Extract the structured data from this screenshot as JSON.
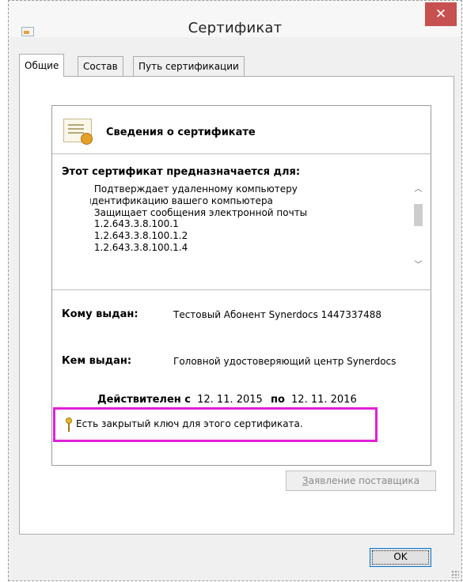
{
  "window": {
    "title": "Сертификат",
    "close_glyph": "✕"
  },
  "tabs": [
    {
      "label": "Общие",
      "active": true
    },
    {
      "label": "Состав",
      "active": false
    },
    {
      "label": "Путь сертификации",
      "active": false
    }
  ],
  "info": {
    "header": "Сведения о сертификате",
    "purpose_title": "Этот сертификат предназначается для:",
    "purposes": [
      "• Подтверждает удаленному компьютеру",
      "идентификацию вашего компьютера",
      "• Защищает сообщения электронной почты",
      "• 1.2.643.3.8.100.1",
      "• 1.2.643.3.8.100.1.2",
      "• 1.2.643.3.8.100.1.4"
    ],
    "issued_to_label": "Кому выдан:",
    "issued_to_value": "Тестовый Абонент Synerdocs 1447337488",
    "issued_by_label": "Кем выдан:",
    "issued_by_value": "Головной удостоверяющий центр Synerdocs",
    "valid_from_label": "Действителен с",
    "valid_from": "12. 11. 2015",
    "valid_to_label": "по",
    "valid_to": "12. 11. 2016",
    "private_key_note": "Есть закрытый ключ для этого сертификата.",
    "highlight_color": "#e020d8"
  },
  "buttons": {
    "issuer_statement_u": "З",
    "issuer_statement_rest": "аявление поставщика",
    "ok": "OK"
  },
  "icons": {
    "app": "certificate-app-icon",
    "cert": "certificate-icon",
    "key": "key-icon",
    "scroll_up": "chevron-up-icon",
    "scroll_down": "chevron-down-icon"
  }
}
